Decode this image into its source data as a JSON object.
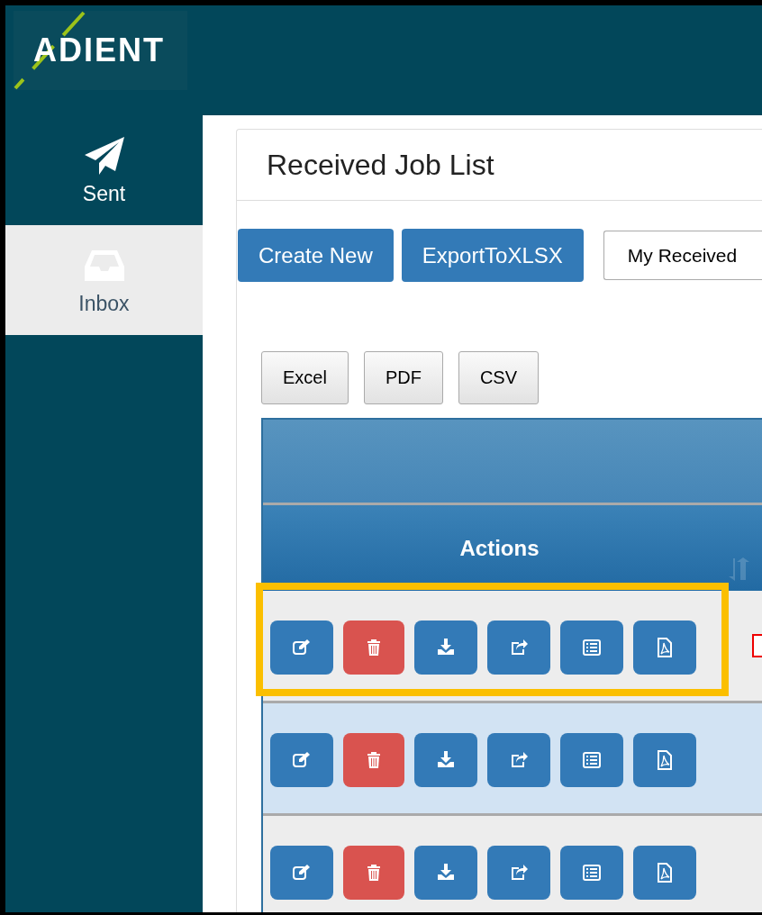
{
  "header": {
    "logo": "ADIENT"
  },
  "sidebar": {
    "items": [
      {
        "kind": "sent",
        "label": "Sent",
        "selected": false
      },
      {
        "kind": "inbox",
        "label": "Inbox",
        "selected": true
      }
    ]
  },
  "panel": {
    "title": "Received Job List",
    "buttons": [
      "Create New",
      "ExportToXLSX"
    ],
    "filter": {
      "value": "My Received"
    },
    "export_buttons": [
      "Excel",
      "PDF",
      "CSV"
    ],
    "table": {
      "columns": [
        "Actions"
      ],
      "rows": [
        {
          "selected": false,
          "highlighted": true,
          "actions": [
            {
              "kind": "edit"
            },
            {
              "kind": "delete"
            },
            {
              "kind": "download"
            },
            {
              "kind": "share"
            },
            {
              "kind": "list"
            },
            {
              "kind": "pdf"
            }
          ]
        },
        {
          "selected": true,
          "highlighted": false,
          "actions": [
            {
              "kind": "edit"
            },
            {
              "kind": "delete"
            },
            {
              "kind": "download"
            },
            {
              "kind": "share"
            },
            {
              "kind": "list"
            },
            {
              "kind": "pdf"
            }
          ]
        },
        {
          "selected": false,
          "highlighted": false,
          "actions": [
            {
              "kind": "edit"
            },
            {
              "kind": "delete"
            },
            {
              "kind": "download"
            },
            {
              "kind": "share"
            },
            {
              "kind": "list"
            },
            {
              "kind": "pdf"
            }
          ]
        }
      ]
    }
  }
}
